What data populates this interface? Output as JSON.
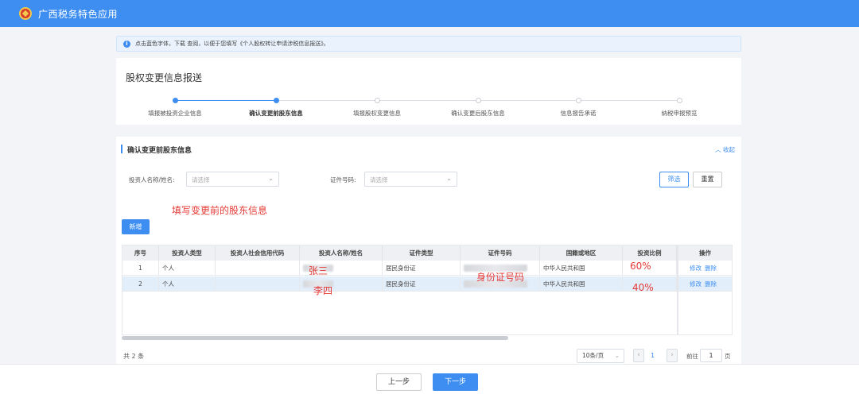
{
  "app": {
    "title": "广西税务特色应用"
  },
  "notice": {
    "text": "点击蓝色字体，下载 查阅，以便于您填写《个人股权转让申请涉税信息报送》。"
  },
  "page": {
    "title": "股权变更信息报送"
  },
  "steps": [
    {
      "label": "填报被投资企业信息",
      "state": "done"
    },
    {
      "label": "确认变更前股东信息",
      "state": "active"
    },
    {
      "label": "填报股权变更信息",
      "state": "pending"
    },
    {
      "label": "确认变更后股东信息",
      "state": "pending"
    },
    {
      "label": "信息报告承诺",
      "state": "pending"
    },
    {
      "label": "纳税申报预览",
      "state": "pending"
    }
  ],
  "section": {
    "title": "确认变更前股东信息",
    "collapse_label": "收起"
  },
  "filters": {
    "investor_label": "投资人名称/姓名:",
    "investor_placeholder": "请选择",
    "id_label": "证件号码:",
    "id_placeholder": "请选择",
    "search_button": "筛选",
    "reset_button": "重置"
  },
  "add_button": "新增",
  "table": {
    "columns": [
      "序号",
      "投资人类型",
      "投资人社会信用代码",
      "投资人名称/姓名",
      "证件类型",
      "证件号码",
      "国籍或地区",
      "投资比例",
      "操作"
    ],
    "rows": [
      {
        "index": "1",
        "type": "个人",
        "credit_code": "",
        "name": "",
        "id_type": "居民身份证",
        "id_no": "",
        "nationality": "中华人民共和国",
        "ratio": "",
        "ops": [
          "修改",
          "删除"
        ]
      },
      {
        "index": "2",
        "type": "个人",
        "credit_code": "",
        "name": "",
        "id_type": "居民身份证",
        "id_no": "",
        "nationality": "中华人民共和国",
        "ratio": "",
        "ops": [
          "修改",
          "删除"
        ]
      }
    ]
  },
  "annotations": {
    "top": "填写变更前的股东信息",
    "name1": "张三",
    "name2": "李四",
    "id_hint": "身份证号码",
    "ratio1": "60%",
    "ratio2": "40%"
  },
  "pagination": {
    "total": "共 2 条",
    "page_size": "10条/页",
    "prev": "‹",
    "current": "1",
    "next": "›",
    "goto_label": "前往",
    "goto_value": "1",
    "goto_unit": "页"
  },
  "footer": {
    "prev_button": "上一步",
    "next_button": "下一步"
  },
  "colors": {
    "primary": "#3d8ef0",
    "annotation": "#e53935"
  }
}
